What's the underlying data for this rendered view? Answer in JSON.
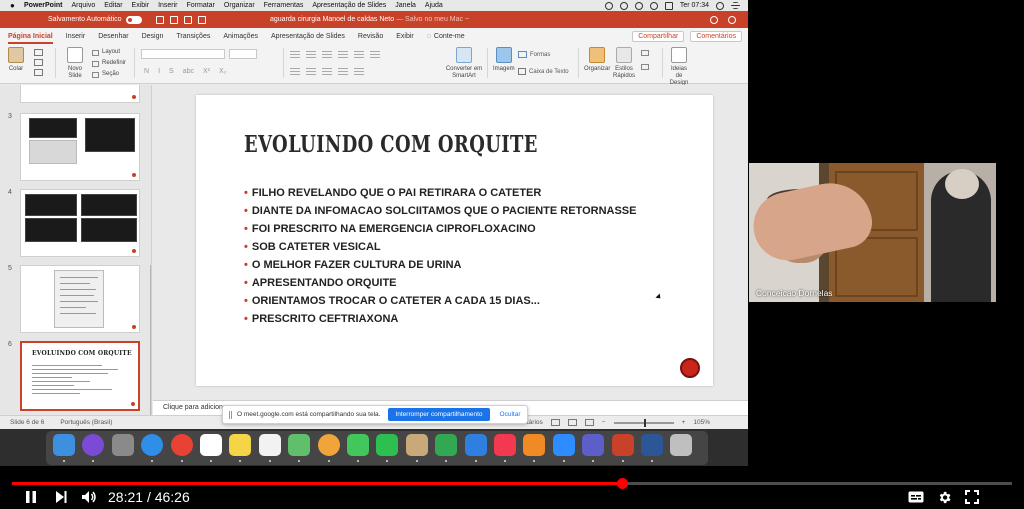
{
  "menubar": {
    "app": "PowerPoint",
    "items": [
      "Arquivo",
      "Editar",
      "Exibir",
      "Inserir",
      "Formatar",
      "Organizar",
      "Ferramentas",
      "Apresentação de Slides",
      "Janela",
      "Ajuda"
    ],
    "clock": "Ter 07:34"
  },
  "titlebar": {
    "autosave": "Salvamento Automático",
    "doc_name": "aguarda cirurgia Manoel de caldas Neto",
    "doc_status": "— Salvo no meu Mac ~"
  },
  "ribbon": {
    "tabs": [
      "Página Inicial",
      "Inserir",
      "Desenhar",
      "Design",
      "Transições",
      "Animações",
      "Apresentação de Slides",
      "Revisão",
      "Exibir"
    ],
    "tell_me": "Conte-me",
    "share": "Compartilhar",
    "comments": "Comentários",
    "paste": "Colar",
    "new_slide": "Novo Slide",
    "layout": "Layout",
    "reset": "Redefinir",
    "section": "Seção",
    "convert_smartart": "Converter em SmartArt",
    "image": "Imagem",
    "shapes": "Formas",
    "textbox": "Caixa de Texto",
    "arrange": "Organizar",
    "quick_styles": "Estilos Rápidos",
    "design_ideas": "Ideias de Design",
    "format_buttons": [
      "N",
      "I",
      "S",
      "abc",
      "X²",
      "X₂"
    ]
  },
  "slides_panel": {
    "numbers": [
      "3",
      "4",
      "5",
      "6"
    ],
    "mini_title": "EVOLUINDO COM ORQUITE"
  },
  "slide": {
    "title": "EVOLUINDO COM ORQUITE",
    "bullet_glyph": "•",
    "bullets": [
      "FILHO REVELANDO QUE O PAI RETIRARA O CATETER",
      "DIANTE DA INFOMACAO SOLCIITAMOS QUE O PACIENTE RETORNASSE",
      "FOI PRESCRITO NA EMERGENCIA CIPROFLOXACINO",
      "SOB CATETER VESICAL",
      "O MELHOR FAZER CULTURA DE URINA",
      "APRESENTANDO ORQUITE",
      "ORIENTAMOS TROCAR O CATETER A CADA  15 DIAS...",
      "PRESCRITO CEFTRIAXONA"
    ]
  },
  "notes_placeholder": "Clique para adicionar",
  "statusbar": {
    "slide_pos": "Slide 6 de 6",
    "language": "Português (Brasil)",
    "comments": "Comentários",
    "zoom": "105%"
  },
  "meet_banner": {
    "message": "O meet.google.com está compartilhando sua tela.",
    "stop": "Interromper compartilhamento",
    "hide": "Ocultar"
  },
  "dock": {
    "apps": [
      {
        "icon": "finder-icon",
        "color": "#3d8fe0"
      },
      {
        "icon": "siri-icon",
        "color": "#7b4bd6"
      },
      {
        "icon": "launchpad-icon",
        "color": "#8a8a8a"
      },
      {
        "icon": "safari-icon",
        "color": "#2f8fe8"
      },
      {
        "icon": "chrome-icon",
        "color": "#e84235"
      },
      {
        "icon": "calendar-icon",
        "color": "#ffffff"
      },
      {
        "icon": "notes-icon",
        "color": "#f5d547"
      },
      {
        "icon": "reminders-icon",
        "color": "#f2f2f2"
      },
      {
        "icon": "maps-icon",
        "color": "#5fbf6a"
      },
      {
        "icon": "photos-icon",
        "color": "#f0a53a"
      },
      {
        "icon": "messages-icon",
        "color": "#41c75b"
      },
      {
        "icon": "facetime-icon",
        "color": "#2dbf4f"
      },
      {
        "icon": "contacts-icon",
        "color": "#c8a97a"
      },
      {
        "icon": "numbers-icon",
        "color": "#32a852"
      },
      {
        "icon": "keynote-icon",
        "color": "#2f7fe0"
      },
      {
        "icon": "music-icon",
        "color": "#f2394f"
      },
      {
        "icon": "books-icon",
        "color": "#f08a24"
      },
      {
        "icon": "zoom-icon",
        "color": "#2d8cff"
      },
      {
        "icon": "teams-icon",
        "color": "#5b5fc7"
      },
      {
        "icon": "powerpoint-icon",
        "color": "#c8422a"
      },
      {
        "icon": "word-icon",
        "color": "#2b5797"
      },
      {
        "icon": "trash-icon",
        "color": "#bfbfbf"
      }
    ]
  },
  "participant": {
    "name": "Conceicao Dornelas"
  },
  "player": {
    "current": "28:21",
    "separator": "/",
    "duration": "46:26",
    "progress": 0.6104
  },
  "colors": {
    "accent": "#c8422a",
    "meet_blue": "#1a73e8",
    "progress_red": "#ff0000"
  }
}
